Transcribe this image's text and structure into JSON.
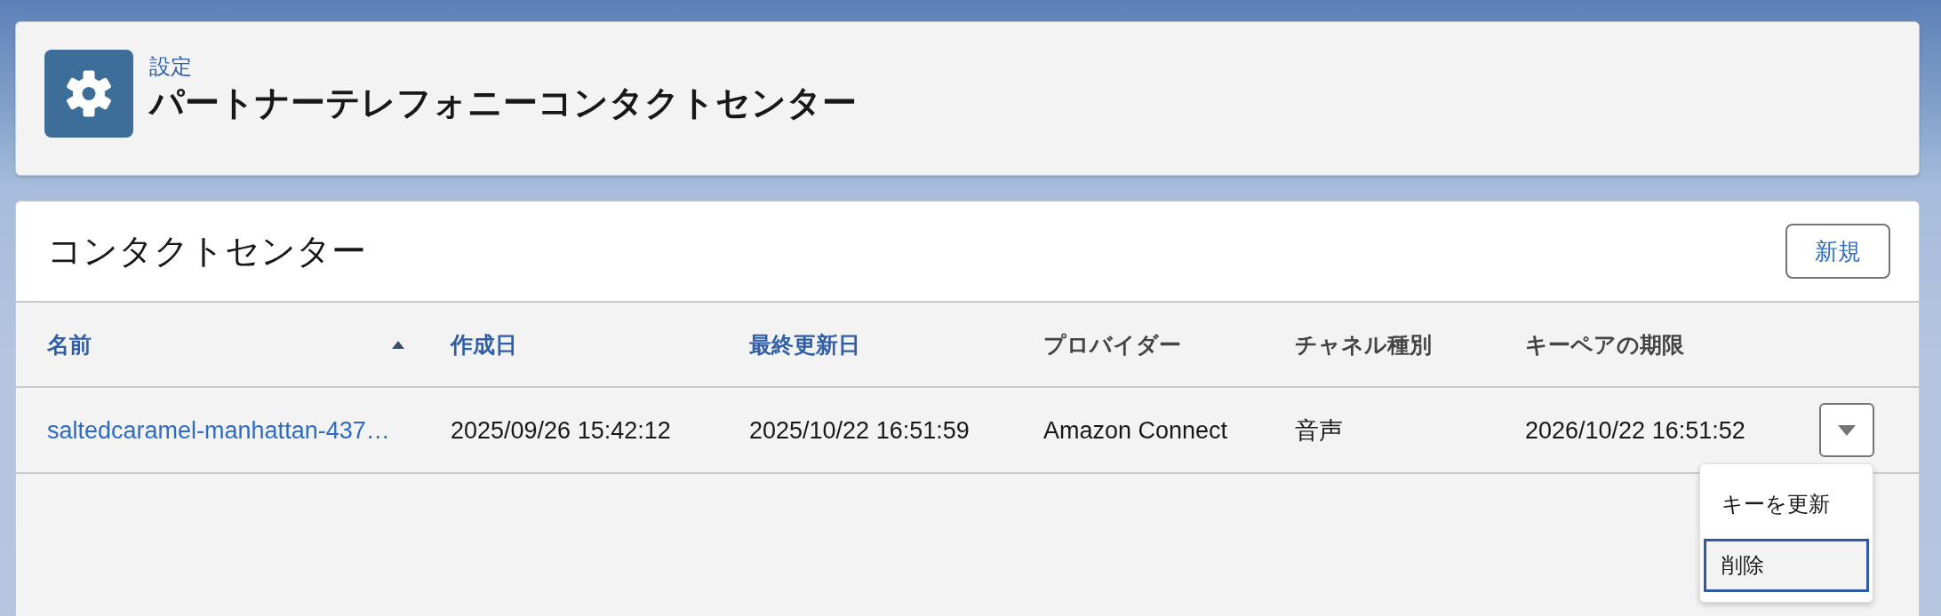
{
  "header": {
    "breadcrumb": "設定",
    "title": "パートナーテレフォニーコンタクトセンター"
  },
  "list": {
    "title": "コンタクトセンター",
    "new_button": "新規",
    "columns": [
      {
        "label": "名前",
        "sortable": true,
        "sorted": true
      },
      {
        "label": "作成日",
        "sortable": true,
        "sorted": false
      },
      {
        "label": "最終更新日",
        "sortable": true,
        "sorted": false
      },
      {
        "label": "プロバイダー",
        "sortable": false,
        "sorted": false
      },
      {
        "label": "チャネル種別",
        "sortable": false,
        "sorted": false
      },
      {
        "label": "キーペアの期限",
        "sortable": false,
        "sorted": false
      }
    ],
    "rows": [
      {
        "cells": [
          {
            "text": "saltedcaramel-manhattan-437…",
            "kind": "link"
          },
          {
            "text": "2025/09/26 15:42:12",
            "kind": "text"
          },
          {
            "text": "2025/10/22 16:51:59",
            "kind": "text"
          },
          {
            "text": "Amazon Connect",
            "kind": "text"
          },
          {
            "text": "音声",
            "kind": "text"
          },
          {
            "text": "2026/10/22 16:51:52",
            "kind": "text"
          }
        ],
        "actions": {
          "expanded": true,
          "items": [
            {
              "label": "キーを更新",
              "selected": false
            },
            {
              "label": "削除",
              "selected": true
            }
          ]
        }
      }
    ]
  }
}
